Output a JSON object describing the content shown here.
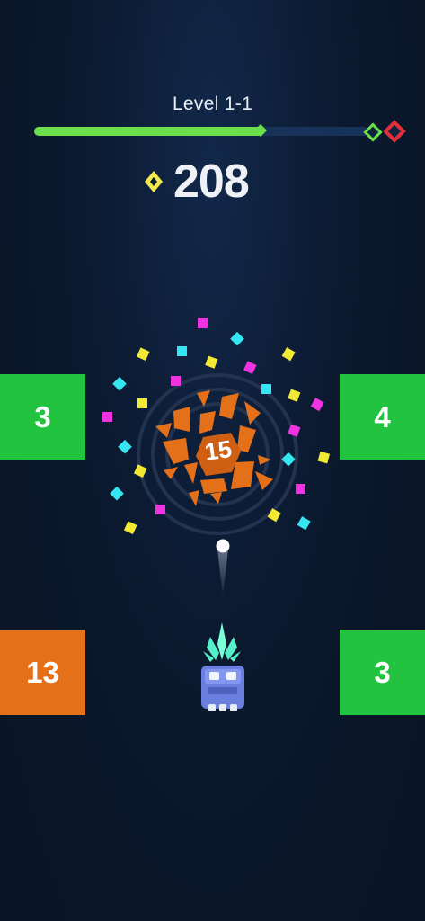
{
  "hud": {
    "level_label": "Level 1-1",
    "level_progress": 0.69,
    "score": "208"
  },
  "blocks": {
    "left_top": "3",
    "right_top": "4",
    "left_bottom": "13",
    "right_bottom": "3"
  },
  "target": {
    "hits_left": "15"
  },
  "colors": {
    "progress_fill": "#6be04a",
    "progress_track": "#17335a",
    "block_green": "#22c33f",
    "block_orange": "#e4701a",
    "gem_yellow": "#f2e94e",
    "checkpoint_green": "#6be04a",
    "checkpoint_red": "#e0303a",
    "player_blue": "#6b7fe0"
  },
  "icons": {
    "score": "yellow-diamond-gem",
    "checkpoint": "green-diamond",
    "goal": "red-diamond"
  }
}
